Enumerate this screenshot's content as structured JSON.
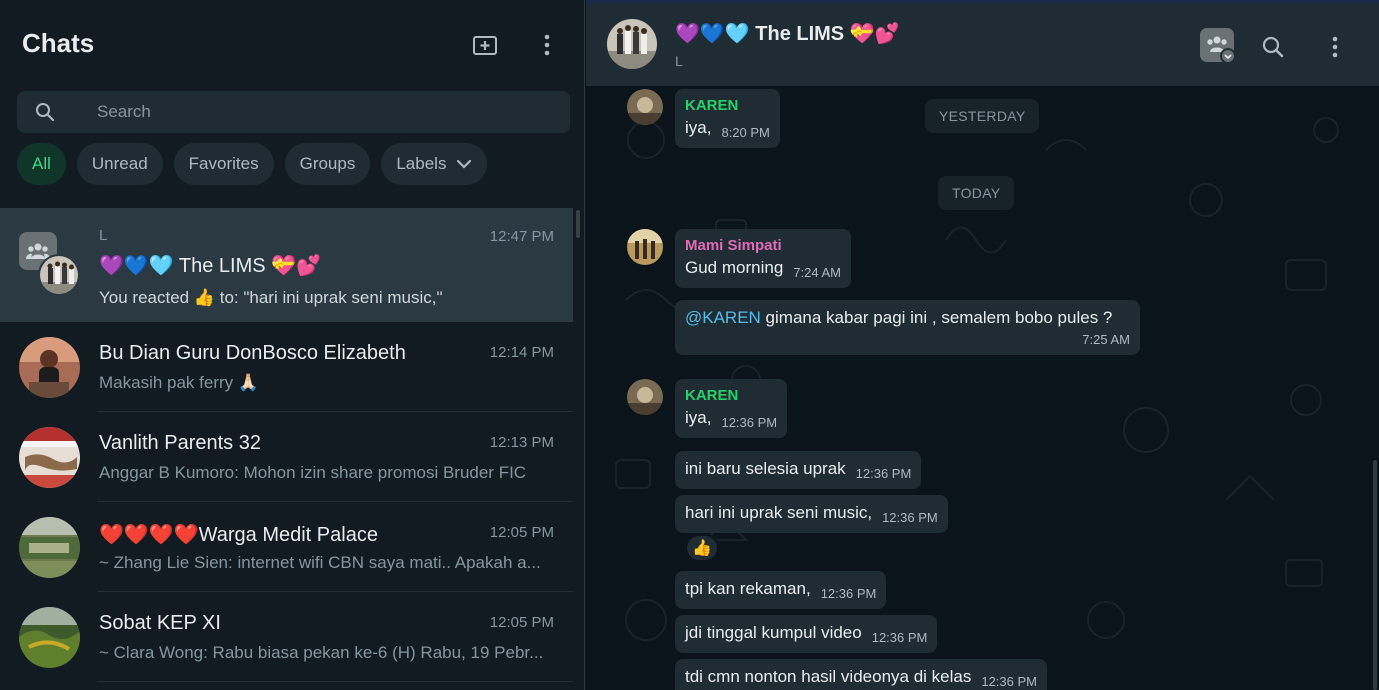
{
  "sidebar": {
    "title": "Chats",
    "search_placeholder": "Search",
    "filters": [
      {
        "label": "All"
      },
      {
        "label": "Unread"
      },
      {
        "label": "Favorites"
      },
      {
        "label": "Groups"
      },
      {
        "label": "Labels"
      }
    ],
    "chats": [
      {
        "label": "L",
        "name": "💜💙🩵 The LIMS 💝💕",
        "time": "12:47 PM",
        "preview": "You reacted 👍 to: \"hari ini uprak seni music,\""
      },
      {
        "name": "Bu Dian Guru DonBosco Elizabeth",
        "time": "12:14 PM",
        "preview": "Makasih pak ferry 🙏🏻"
      },
      {
        "name": "Vanlith Parents 32",
        "time": "12:13 PM",
        "preview": "Anggar B Kumoro: Mohon izin share promosi Bruder FIC"
      },
      {
        "name": "❤️❤️❤️❤️Warga Medit Palace",
        "time": "12:05 PM",
        "preview": "~ Zhang Lie Sien: internet wifi CBN saya mati.. Apakah a..."
      },
      {
        "name": "Sobat KEP XI",
        "time": "12:05 PM",
        "preview": "~ Clara Wong: Rabu biasa pekan ke-6 (H) Rabu, 19 Pebr..."
      }
    ]
  },
  "conversation": {
    "title": "💜💙🩵 The LIMS 💝💕",
    "subtitle": "L",
    "badges": {
      "yesterday": "YESTERDAY",
      "today": "TODAY"
    },
    "messages": [
      {
        "sender": "KAREN",
        "text": "iya,",
        "time": "8:20 PM"
      },
      {
        "sender": "Mami Simpati",
        "text": "Gud morning",
        "time": "7:24 AM"
      },
      {
        "mention": "@KAREN",
        "text": " gimana kabar pagi ini , semalem bobo pules ?",
        "time": "7:25 AM"
      },
      {
        "sender": "KAREN",
        "text": "iya,",
        "time": "12:36 PM"
      },
      {
        "text": "ini baru selesia uprak",
        "time": "12:36 PM"
      },
      {
        "text": "hari ini uprak seni music,",
        "time": "12:36 PM",
        "reaction": "👍"
      },
      {
        "text": "tpi kan rekaman,",
        "time": "12:36 PM"
      },
      {
        "text": "jdi tinggal kumpul video",
        "time": "12:36 PM"
      },
      {
        "text": "tdi cmn nonton hasil videonya di kelas",
        "time": "12:36 PM"
      }
    ]
  },
  "colors": {
    "accent": "#00a884",
    "karen": "#25d366",
    "mami": "#e26ab6",
    "mention": "#53bdeb"
  }
}
